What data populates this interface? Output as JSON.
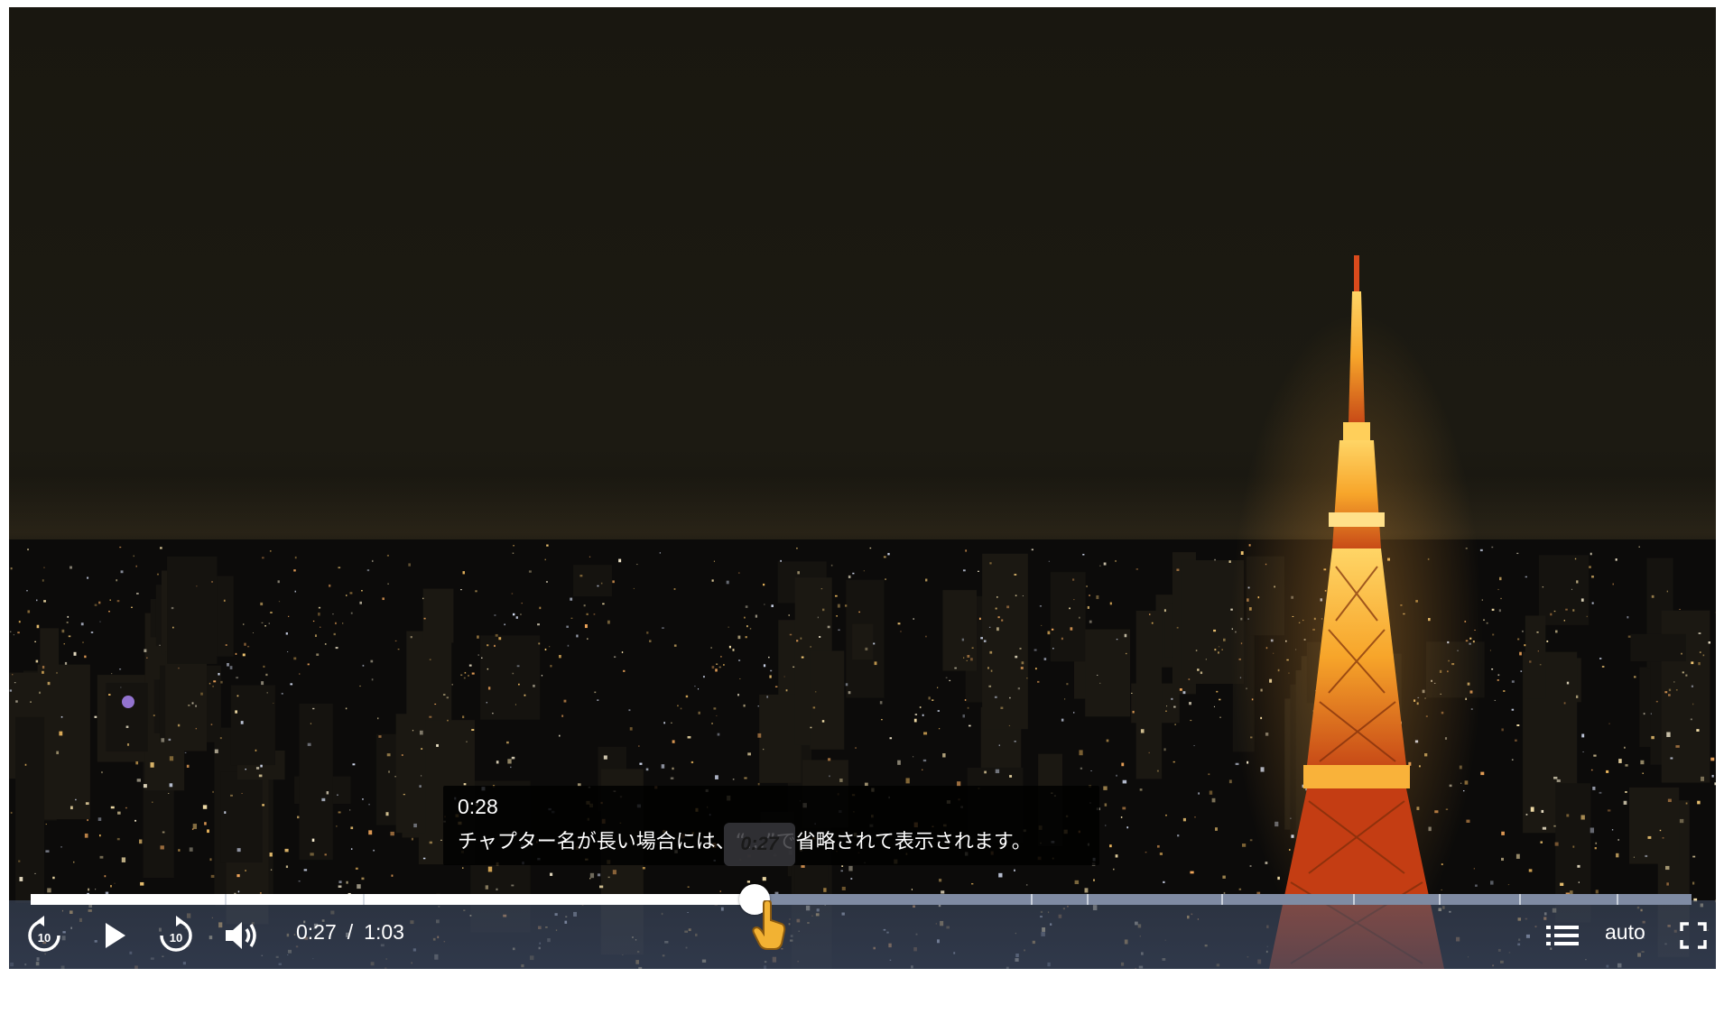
{
  "player": {
    "tooltip": {
      "time": "0:28",
      "chapter_title": "チャプター名が長い場合には、“…”で省略されて表示されます。"
    },
    "scrub_preview": "0:27",
    "current_time": "0:27",
    "separator": "/",
    "duration": "1:03",
    "quality": "auto",
    "progress_fraction": 0.436,
    "chapter_marks": [
      0.117,
      0.2,
      0.602,
      0.636,
      0.717,
      0.796,
      0.848,
      0.896,
      0.955
    ],
    "icons": {
      "rewind": "rewind-10-icon",
      "play": "play-icon",
      "forward": "forward-10-icon",
      "volume": "volume-icon",
      "chapters": "chapter-list-icon",
      "fullscreen": "fullscreen-icon"
    },
    "skip_seconds": "10",
    "colors": {
      "played": "#ffffff",
      "track": "#7f8ba3",
      "tower": "#f5a623"
    }
  }
}
